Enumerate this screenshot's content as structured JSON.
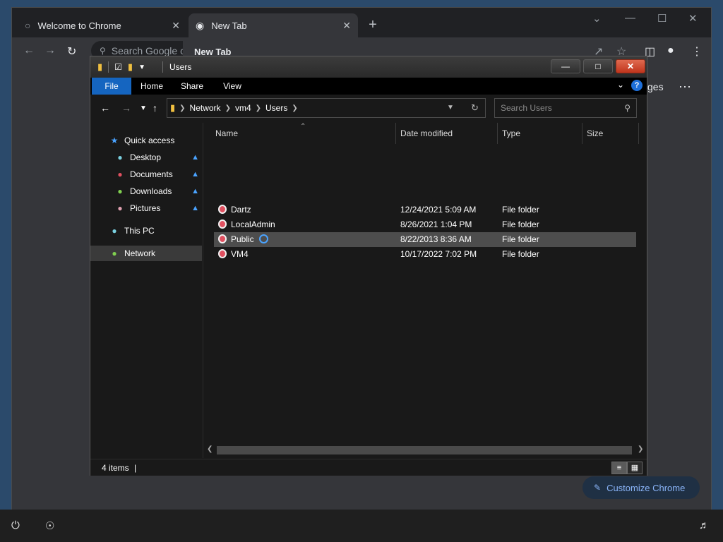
{
  "browser": {
    "tabs": [
      {
        "title": "Welcome to Chrome",
        "icon": "globe-icon",
        "active": false
      },
      {
        "title": "New Tab",
        "icon": "chrome-icon",
        "active": true
      }
    ],
    "omnibox_placeholder": "Search Google c",
    "tab_hover_title": "New Tab",
    "images_link": "ges",
    "customize_label": "Customize Chrome"
  },
  "explorer": {
    "title": "Users",
    "ribbon_tabs": [
      "File",
      "Home",
      "Share",
      "View"
    ],
    "breadcrumb": [
      "Network",
      "vm4",
      "Users"
    ],
    "search_placeholder": "Search Users",
    "nav": {
      "quick_access": "Quick access",
      "desktop": "Desktop",
      "documents": "Documents",
      "downloads": "Downloads",
      "pictures": "Pictures",
      "this_pc": "This PC",
      "network": "Network"
    },
    "columns": {
      "name": "Name",
      "date": "Date modified",
      "type": "Type",
      "size": "Size"
    },
    "rows": [
      {
        "name": "Dartz",
        "date": "12/24/2021 5:09 AM",
        "type": "File folder",
        "size": ""
      },
      {
        "name": "LocalAdmin",
        "date": "8/26/2021 1:04 PM",
        "type": "File folder",
        "size": ""
      },
      {
        "name": "Public",
        "date": "8/22/2013 8:36 AM",
        "type": "File folder",
        "size": ""
      },
      {
        "name": "VM4",
        "date": "10/17/2022 7:02 PM",
        "type": "File folder",
        "size": ""
      }
    ],
    "selected_row": "Public",
    "status": "4 items"
  },
  "colors": {
    "accent": "#1565c0",
    "selection": "#4d4d4d",
    "close_button": "#c0341c",
    "link": "#8ab4f8"
  }
}
